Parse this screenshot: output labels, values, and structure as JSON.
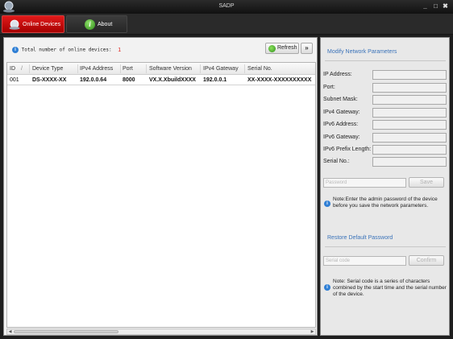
{
  "window": {
    "title": "SADP",
    "minimize": "_",
    "maximize": "□",
    "close": "✖"
  },
  "tabs": [
    {
      "label": "Online Devices",
      "icon": "network-globe-icon",
      "active": true
    },
    {
      "label": "About",
      "icon": "info-icon",
      "active": false
    }
  ],
  "device_list": {
    "count_label": "Total number of online devices:",
    "count_value": "1",
    "refresh_label": "Refresh",
    "more_label": "»",
    "sort_indicator": "/",
    "columns": [
      "ID",
      "Device Type",
      "IPv4 Address",
      "Port",
      "Software Version",
      "IPv4 Gateway",
      "Serial No."
    ],
    "rows": [
      {
        "id": "001",
        "device_type": "DS-XXXX-XX",
        "ipv4": "192.0.0.64",
        "port": "8000",
        "software": "VX.X.XbuildXXXX",
        "gateway": "192.0.0.1",
        "serial": "XX-XXXX-XXXXXXXXXX"
      }
    ]
  },
  "modify_panel": {
    "title": "Modify Network Parameters",
    "fields": [
      {
        "label": "IP Address:",
        "value": ""
      },
      {
        "label": "Port:",
        "value": ""
      },
      {
        "label": "Subnet Mask:",
        "value": ""
      },
      {
        "label": "IPv4 Gateway:",
        "value": ""
      },
      {
        "label": "IPv6 Address:",
        "value": ""
      },
      {
        "label": "IPv6 Gateway:",
        "value": ""
      },
      {
        "label": "IPv6 Prefix Length:",
        "value": ""
      },
      {
        "label": "Serial No.:",
        "value": ""
      }
    ],
    "password_placeholder": "Password",
    "save_label": "Save",
    "note": "Note:Enter the admin password of the device before you save the network parameters."
  },
  "restore_panel": {
    "title": "Restore Default Password",
    "serial_placeholder": "Serial code",
    "confirm_label": "Confirm",
    "note": "Note: Serial code is a series of characters combined by the start time and the serial number of the device."
  },
  "colors": {
    "accent_red": "#cc0000",
    "link_blue": "#3b73b9",
    "count_red": "#e0201a"
  }
}
